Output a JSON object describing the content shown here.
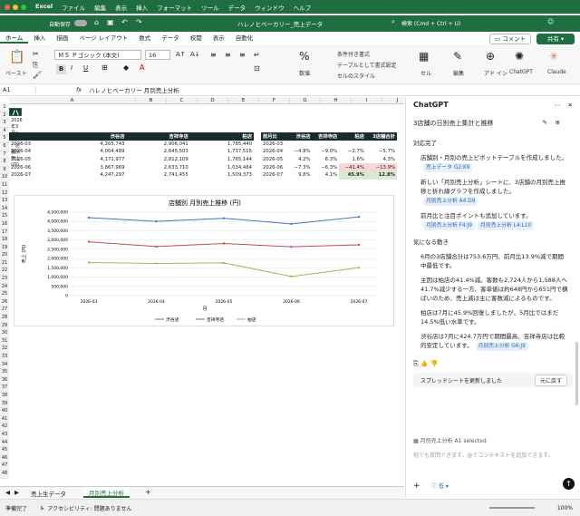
{
  "titlebar": {
    "app": "Excel",
    "menus": [
      "ファイル",
      "編集",
      "表示",
      "挿入",
      "フォーマット",
      "ツール",
      "データ",
      "ウィンドウ",
      "ヘルプ"
    ],
    "autosave": "自動保存",
    "doc_title": "ハレノヒベーカリー_売上データ",
    "search_placeholder": "検索 (Cmd + Ctrl + U)"
  },
  "tabs": [
    "ホーム",
    "挿入",
    "描画",
    "ページ レイアウト",
    "数式",
    "データ",
    "校閲",
    "表示",
    "自動化"
  ],
  "comment_label": "コメント",
  "share_label": "共有",
  "ribbon": {
    "paste": "ペースト",
    "font": "ＭＳ Ｐゴシック (本文)",
    "font_size": "16",
    "number": "数値",
    "cond_format": "条件付き書式",
    "table_format": "テーブルとして書式設定",
    "cell_style": "セルのスタイル",
    "cell": "セル",
    "edit": "編集",
    "addin": "アド イン",
    "chatgpt": "ChatGPT",
    "claude": "Claude"
  },
  "formula_bar": {
    "cell": "A1",
    "fx": "fx",
    "value": "ハレノヒベーカリー 月別売上分析"
  },
  "columns": [
    "A",
    "B",
    "C",
    "D",
    "E",
    "F",
    "G",
    "H",
    "I",
    "J",
    "K"
  ],
  "rows": [
    "1",
    "2",
    "3",
    "4",
    "5",
    "6",
    "7",
    "8",
    "9",
    "10",
    "11",
    "12",
    "13",
    "14",
    "15",
    "16",
    "17",
    "18",
    "19",
    "20",
    "21",
    "22",
    "23",
    "24",
    "25",
    "26",
    "27",
    "28",
    "29",
    "30",
    "31",
    "32",
    "33",
    "34",
    "35",
    "36",
    "37",
    "38",
    "39",
    "40",
    "41",
    "42",
    "43",
    "44",
    "45",
    "46",
    "47",
    "48"
  ],
  "sheet": {
    "title": "ハレノヒベーカリー 月別売上分析",
    "subtitle": "2026年3月〜7月／店舗別売上 (円)",
    "left_headers": [
      "",
      "渋谷店",
      "吉祥寺店",
      "柏店"
    ],
    "left_rows": [
      [
        "2026-03",
        "4,205,743",
        "2,906,041",
        "1,785,440"
      ],
      [
        "2026-04",
        "4,004,489",
        "2,645,503",
        "1,737,515"
      ],
      [
        "2026-05",
        "4,171,977",
        "2,812,109",
        "1,765,144"
      ],
      [
        "2026-06",
        "3,867,969",
        "2,633,710",
        "1,034,484"
      ],
      [
        "2026-07",
        "4,247,297",
        "2,741,455",
        "1,509,373"
      ]
    ],
    "right_headers": [
      "前月比",
      "渋谷店",
      "吉祥寺店",
      "柏店",
      "3店舗合計"
    ],
    "right_rows": [
      [
        "2026-03",
        "",
        "",
        "",
        ""
      ],
      [
        "2026-04",
        "−4.8%",
        "−9.0%",
        "−2.7%",
        "−5.7%"
      ],
      [
        "2026-05",
        "4.2%",
        "6.3%",
        "1.6%",
        "4.3%"
      ],
      [
        "2026-06",
        "−7.3%",
        "−6.3%",
        "−41.4%",
        "−13.9%"
      ],
      [
        "2026-07",
        "9.8%",
        "4.1%",
        "45.9%",
        "12.8%"
      ]
    ]
  },
  "chart_data": {
    "type": "line",
    "title": "店舗別 月別売上推移 (円)",
    "xlabel": "月",
    "ylabel": "売上 (円)",
    "x": [
      "2026-03",
      "2026-04",
      "2026-05",
      "2026-06",
      "2026-07"
    ],
    "ylim": [
      0,
      4500000
    ],
    "yticks": [
      "0",
      "500,000",
      "1,000,000",
      "1,500,000",
      "2,000,000",
      "2,500,000",
      "3,000,000",
      "3,500,000",
      "4,000,000",
      "4,500,000"
    ],
    "legend": "bottom",
    "series": [
      {
        "name": "渋谷店",
        "color": "#4a72c4",
        "values": [
          4205743,
          4004489,
          4171977,
          3867969,
          4247297
        ]
      },
      {
        "name": "吉祥寺店",
        "color": "#c0504d",
        "values": [
          2906041,
          2645503,
          2812109,
          2633710,
          2741455
        ]
      },
      {
        "name": "柏店",
        "color": "#9bbb59",
        "values": [
          1785440,
          1737515,
          1765144,
          1034484,
          1509373
        ]
      }
    ]
  },
  "chat": {
    "title": "ChatGPT",
    "task": "3店舗の日別売上集計と推移",
    "done_label": "対応完了",
    "done_items": [
      {
        "text": "店舗別・月別の売上ピボットテーブルを作成しました。",
        "refs": [
          "売上データ G2:K9"
        ]
      },
      {
        "text": "新しい「月別売上分析」シートに、3店舗の月別売上推移と折れ線グラフを作成しました。",
        "refs": [
          "月別売上分析 A4:D9"
        ]
      },
      {
        "text": "前月比と注目ポイントも追加しています。",
        "refs": [
          "月別売上分析 F4:J9",
          "月別売上分析 L4:L10"
        ]
      }
    ],
    "notice_label": "気になる動き",
    "notice_items": [
      {
        "text": "6月の3店舗合計は753.6万円、前月比13.9%減で期間中最低です。",
        "refs": []
      },
      {
        "text": "主因は柏店の41.4%減。客数も2,724人から1,588人へ41.7%減少する一方、客単価は約648円から651円で横ばいのため、売上減は主に客数減によるものです。",
        "refs": []
      },
      {
        "text": "柏店は7月に45.9%回復しましたが、5月比ではまだ14.5%低い水準です。",
        "refs": []
      },
      {
        "text": "渋谷店は7月に424.7万円で期間最高、吉祥寺店は比較的安定しています。",
        "refs": [
          "月別売上分析 G6:J9"
        ]
      }
    ],
    "updated": "スプレッドシートを更新しました",
    "undo": "元に戻す",
    "context": "月別売上分析 A1 selected",
    "input_placeholder": "何でも質問できます。@でコンテキストを追加できます。",
    "mode": "低"
  },
  "sheet_tabs": [
    "売上生データ",
    "月別売上分析"
  ],
  "status": {
    "ready": "準備完了",
    "access": "アクセシビリティ: 問題ありません",
    "zoom": "100%"
  }
}
